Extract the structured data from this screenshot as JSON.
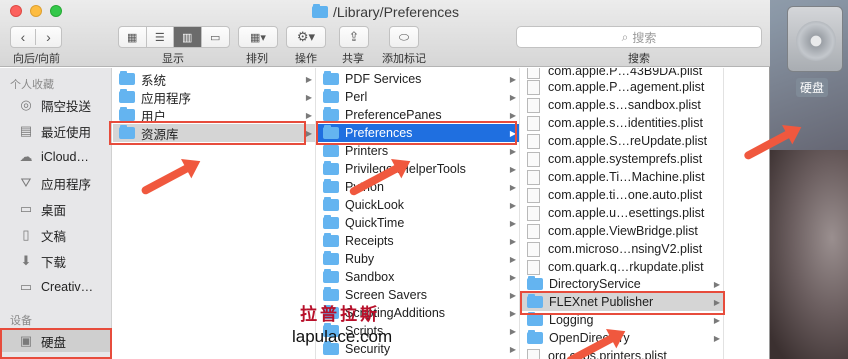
{
  "window": {
    "title": "/Library/Preferences"
  },
  "toolbar": {
    "nav_label": "向后/向前",
    "view_label": "显示",
    "arrange_label": "排列",
    "action_label": "操作",
    "share_label": "共享",
    "tags_label": "添加标记",
    "search_label": "搜索",
    "search_placeholder": "搜索"
  },
  "sidebar": {
    "favorites_header": "个人收藏",
    "favorites": [
      {
        "label": "隔空投送",
        "icon": "airdrop-icon"
      },
      {
        "label": "最近使用",
        "icon": "recents-icon"
      },
      {
        "label": "iCloud…",
        "icon": "icloud-icon"
      },
      {
        "label": "应用程序",
        "icon": "applications-icon"
      },
      {
        "label": "桌面",
        "icon": "desktop-icon"
      },
      {
        "label": "文稿",
        "icon": "documents-icon"
      },
      {
        "label": "下载",
        "icon": "downloads-icon"
      },
      {
        "label": "Creativ…",
        "icon": "folder-icon"
      }
    ],
    "devices_header": "设备",
    "devices": [
      {
        "label": "硬盘",
        "icon": "harddisk-icon"
      }
    ]
  },
  "column1": [
    {
      "label": "系统"
    },
    {
      "label": "应用程序"
    },
    {
      "label": "用户"
    },
    {
      "label": "资源库"
    }
  ],
  "column2": [
    {
      "label": "PDF Services"
    },
    {
      "label": "Perl"
    },
    {
      "label": "PreferencePanes"
    },
    {
      "label": "Preferences"
    },
    {
      "label": "Printers"
    },
    {
      "label": "PrivilegedHelperTools"
    },
    {
      "label": "Python"
    },
    {
      "label": "QuickLook"
    },
    {
      "label": "QuickTime"
    },
    {
      "label": "Receipts"
    },
    {
      "label": "Ruby"
    },
    {
      "label": "Sandbox"
    },
    {
      "label": "Screen Savers"
    },
    {
      "label": "ScriptingAdditions"
    },
    {
      "label": "Scripts"
    },
    {
      "label": "Security"
    }
  ],
  "column3": [
    {
      "label": "com.apple.P…43B9DA.plist",
      "kind": "file"
    },
    {
      "label": "com.apple.P…agement.plist",
      "kind": "file"
    },
    {
      "label": "com.apple.s…sandbox.plist",
      "kind": "file"
    },
    {
      "label": "com.apple.s…identities.plist",
      "kind": "file"
    },
    {
      "label": "com.apple.S…reUpdate.plist",
      "kind": "file"
    },
    {
      "label": "com.apple.systemprefs.plist",
      "kind": "file"
    },
    {
      "label": "com.apple.Ti…Machine.plist",
      "kind": "file"
    },
    {
      "label": "com.apple.ti…one.auto.plist",
      "kind": "file"
    },
    {
      "label": "com.apple.u…esettings.plist",
      "kind": "file"
    },
    {
      "label": "com.apple.ViewBridge.plist",
      "kind": "file"
    },
    {
      "label": "com.microso…nsingV2.plist",
      "kind": "file"
    },
    {
      "label": "com.quark.q…rkupdate.plist",
      "kind": "file"
    },
    {
      "label": "DirectoryService",
      "kind": "folder"
    },
    {
      "label": "FLEXnet Publisher",
      "kind": "folder"
    },
    {
      "label": "Logging",
      "kind": "folder"
    },
    {
      "label": "OpenDirectory",
      "kind": "folder"
    },
    {
      "label": "org.cups.printers.plist",
      "kind": "file"
    }
  ],
  "desktop": {
    "disk_label": "硬盘"
  },
  "watermark": {
    "cn": "拉普拉斯",
    "en": "lapulace.com"
  },
  "colors": {
    "selection_blue": "#1f6fe0",
    "highlight_red": "#e74c3c",
    "folder_blue": "#64b4f0"
  }
}
